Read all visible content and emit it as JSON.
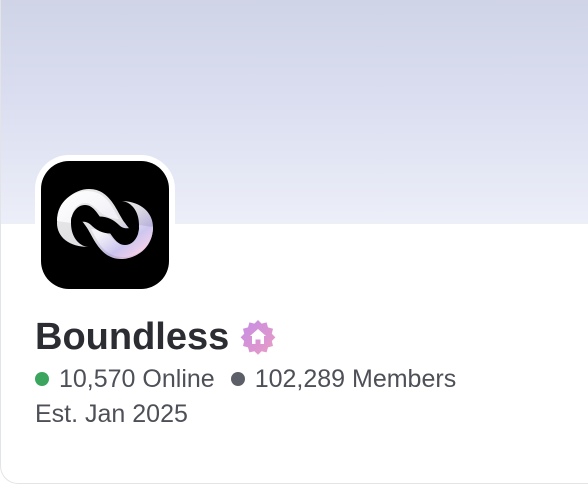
{
  "server": {
    "name": "Boundless",
    "badge_icon": "community-home-badge-icon",
    "avatar_icon": "boundless-wave-logo-icon",
    "online": "10,570 Online",
    "members": "102,289 Members",
    "established": "Est. Jan 2025"
  },
  "colors": {
    "online_dot": "#3ba55d",
    "members_dot": "#5d5f68",
    "badge_gradient_start": "#c48de6",
    "badge_gradient_end": "#ea9cc4",
    "banner_top": "#cfd4e6",
    "banner_bottom": "#eceff8"
  }
}
